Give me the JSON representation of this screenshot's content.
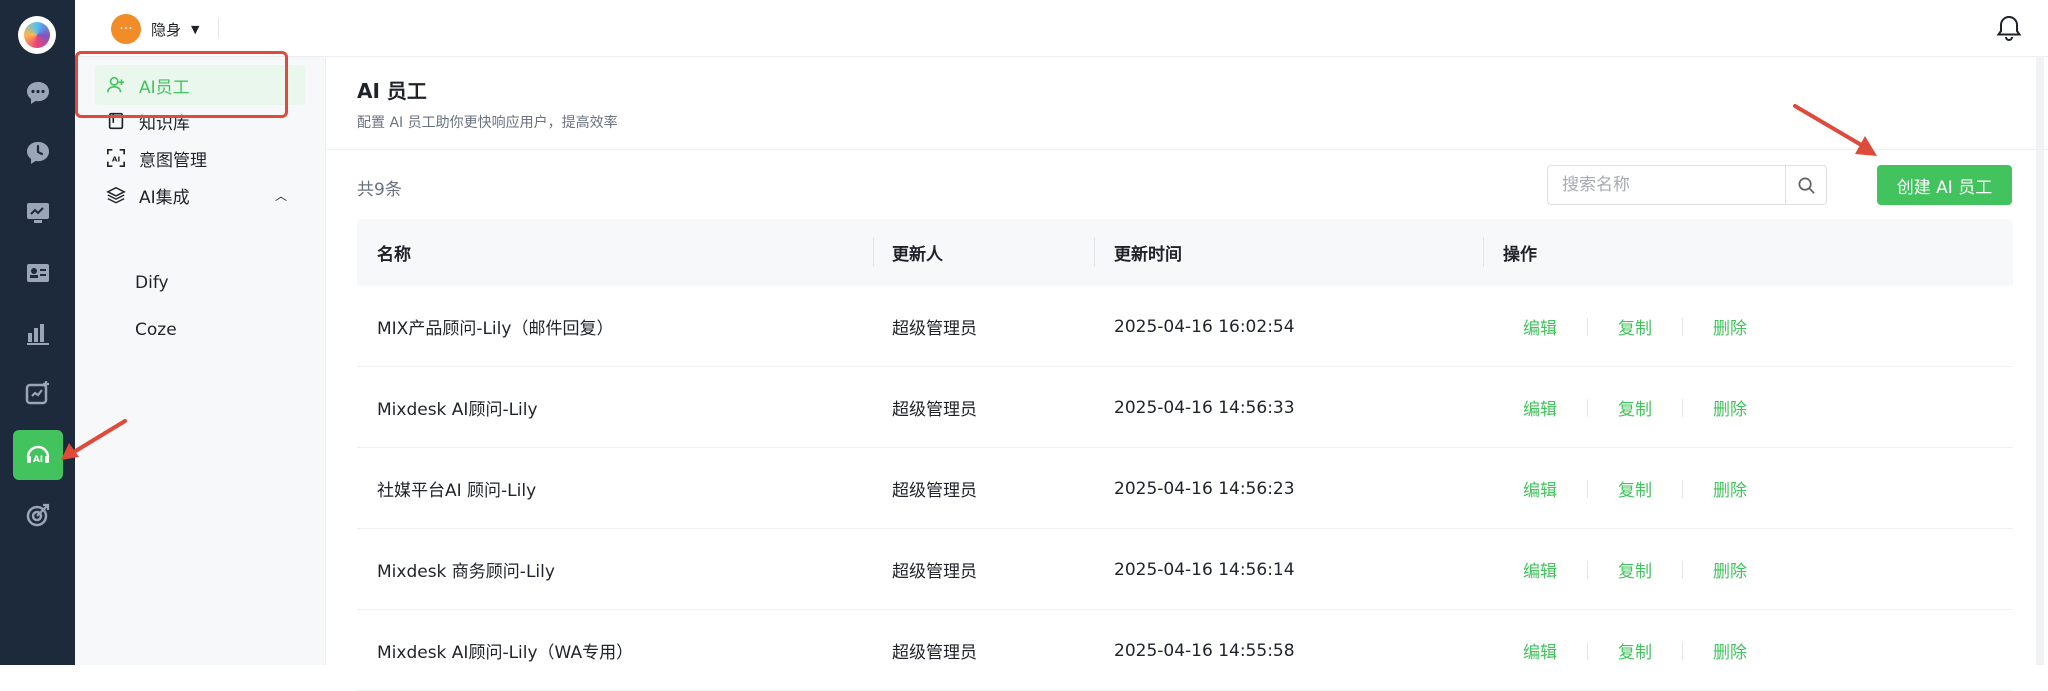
{
  "topbar": {
    "status_label": "隐身",
    "status_bubble": "···"
  },
  "subnav": {
    "items": [
      {
        "label": "AI员工",
        "icon": "user-add-icon"
      },
      {
        "label": "知识库",
        "icon": "book-icon"
      },
      {
        "label": "意图管理",
        "icon": "ai-scan-icon"
      },
      {
        "label": "AI集成",
        "icon": "layers-icon"
      }
    ],
    "subitems": [
      {
        "label": "Dify"
      },
      {
        "label": "Coze"
      }
    ]
  },
  "main": {
    "title": "AI 员工",
    "subtitle": "配置 AI 员工助你更快响应用户，提高效率",
    "count": "共9条",
    "search_placeholder": "搜索名称",
    "create_label": "创建 AI 员工"
  },
  "table": {
    "headers": {
      "name": "名称",
      "updater": "更新人",
      "time": "更新时间",
      "ops": "操作"
    },
    "actions": {
      "edit": "编辑",
      "copy": "复制",
      "delete": "删除"
    },
    "rows": [
      {
        "name": "MIX产品顾问-Lily（邮件回复）",
        "updater": "超级管理员",
        "time": "2025-04-16 16:02:54"
      },
      {
        "name": "Mixdesk AI顾问-Lily",
        "updater": "超级管理员",
        "time": "2025-04-16 14:56:33"
      },
      {
        "name": "社媒平台AI 顾问-Lily",
        "updater": "超级管理员",
        "time": "2025-04-16 14:56:23"
      },
      {
        "name": "Mixdesk 商务顾问-Lily",
        "updater": "超级管理员",
        "time": "2025-04-16 14:56:14"
      },
      {
        "name": "Mixdesk AI顾问-Lily（WA专用）",
        "updater": "超级管理员",
        "time": "2025-04-16 14:55:58"
      }
    ]
  },
  "colors": {
    "accent": "#43c35e",
    "rail": "#1d2a3c",
    "annotation": "#e04a3a"
  }
}
